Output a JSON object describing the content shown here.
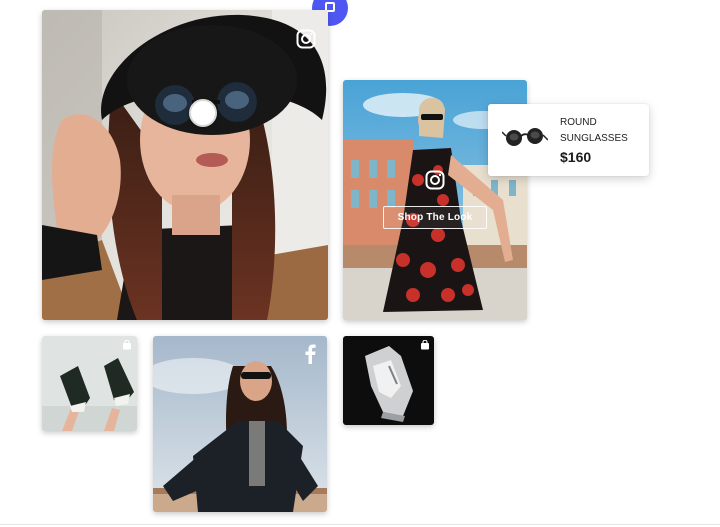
{
  "gallery": {
    "tiles": [
      {
        "subject": "woman-hat-sunglasses",
        "network_icon": "instagram-icon"
      },
      {
        "subject": "woman-floral-dress",
        "network_icon": "instagram-icon",
        "button_label": "Shop The Look"
      },
      {
        "subject": "sneakers-feet",
        "network_icon": "shopping-bag-icon"
      },
      {
        "subject": "woman-leather-jacket",
        "network_icon": "facebook-icon"
      },
      {
        "subject": "silver-sneakers",
        "network_icon": "shopping-bag-icon"
      }
    ]
  },
  "product_popup": {
    "name": "ROUND SUNGLASSES",
    "price": "$160",
    "image": "sunglasses-icon"
  },
  "colors": {
    "accent": "#4f57f2",
    "popup_bg": "#ffffff",
    "text": "#1c1c1c"
  }
}
